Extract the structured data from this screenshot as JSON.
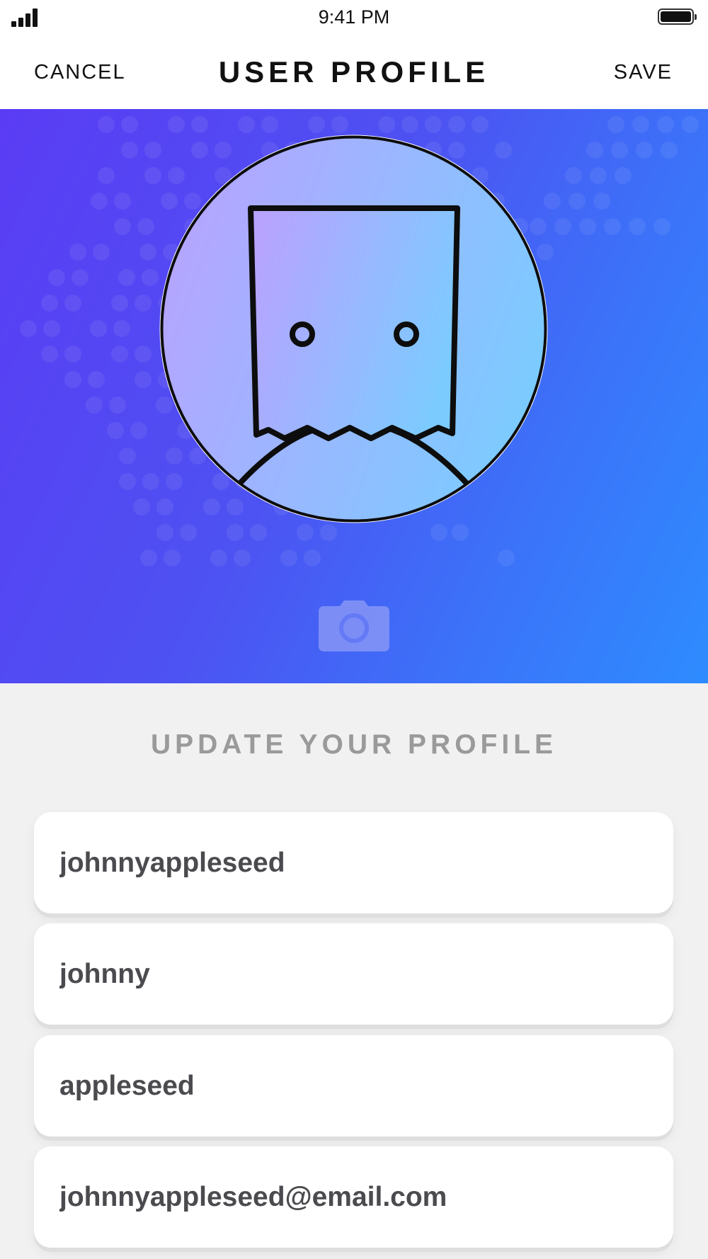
{
  "status_bar": {
    "time": "9:41 PM",
    "signal_icon": "cellular-signal-icon",
    "battery_icon": "battery-full-icon"
  },
  "nav": {
    "cancel_label": "CANCEL",
    "title": "USER PROFILE",
    "save_label": "SAVE"
  },
  "hero": {
    "avatar_icon": "paper-bag-avatar",
    "camera_icon": "camera-icon",
    "colors": {
      "gradient_start": "#5a3cf4",
      "gradient_end": "#2e8cff",
      "avatar_start": "#b8a3ff",
      "avatar_end": "#7ccbff"
    }
  },
  "form": {
    "title": "UPDATE YOUR PROFILE",
    "fields": [
      {
        "value": "johnnyappleseed"
      },
      {
        "value": "johnny"
      },
      {
        "value": "appleseed"
      },
      {
        "value": "johnnyappleseed@email.com"
      }
    ]
  }
}
